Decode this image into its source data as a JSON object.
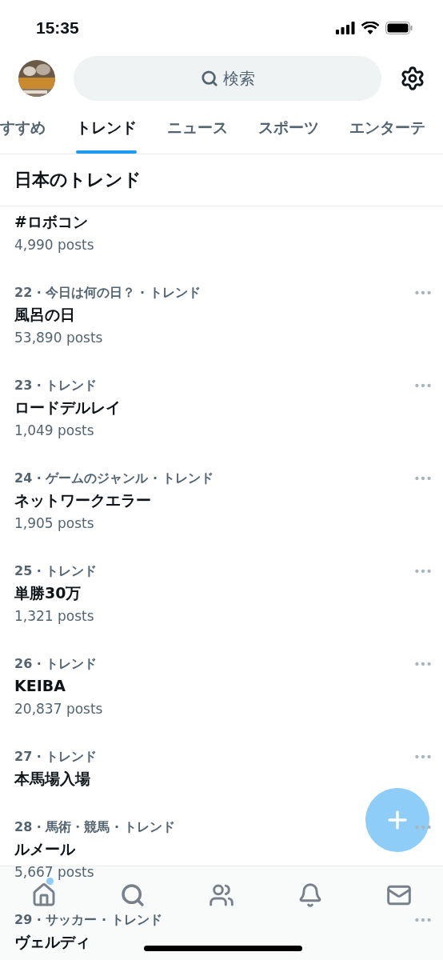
{
  "status_bar": {
    "time": "15:35"
  },
  "search": {
    "placeholder": "検索"
  },
  "tabs": [
    {
      "label": "すすめ",
      "selected": false
    },
    {
      "label": "トレンド",
      "selected": true
    },
    {
      "label": "ニュース",
      "selected": false
    },
    {
      "label": "スポーツ",
      "selected": false
    },
    {
      "label": "エンターテ",
      "selected": false
    }
  ],
  "section_title": "日本のトレンド",
  "trends": [
    {
      "title": "#ロボコン",
      "posts": "4,990 posts"
    },
    {
      "meta": "22 · 今日は何の日？ · トレンド",
      "title": "風呂の日",
      "posts": "53,890 posts"
    },
    {
      "meta": "23 · トレンド",
      "title": "ロードデルレイ",
      "posts": "1,049 posts"
    },
    {
      "meta": "24 · ゲームのジャンル · トレンド",
      "title": "ネットワークエラー",
      "posts": "1,905 posts"
    },
    {
      "meta": "25 · トレンド",
      "title": "単勝30万",
      "posts": "1,321 posts"
    },
    {
      "meta": "26 · トレンド",
      "title": "KEIBA",
      "posts": "20,837 posts"
    },
    {
      "meta": "27 · トレンド",
      "title": "本馬場入場"
    },
    {
      "meta": "28 · 馬術・競馬 · トレンド",
      "title": "ルメール",
      "posts": "5,667 posts"
    },
    {
      "meta": "29 · サッカー · トレンド",
      "title": "ヴェルディ"
    }
  ],
  "bottom_nav": [
    {
      "kind": "home",
      "unread": true
    },
    {
      "kind": "search",
      "unread": false
    },
    {
      "kind": "communities",
      "unread": false
    },
    {
      "kind": "notifications",
      "unread": false
    },
    {
      "kind": "messages",
      "unread": false
    }
  ]
}
